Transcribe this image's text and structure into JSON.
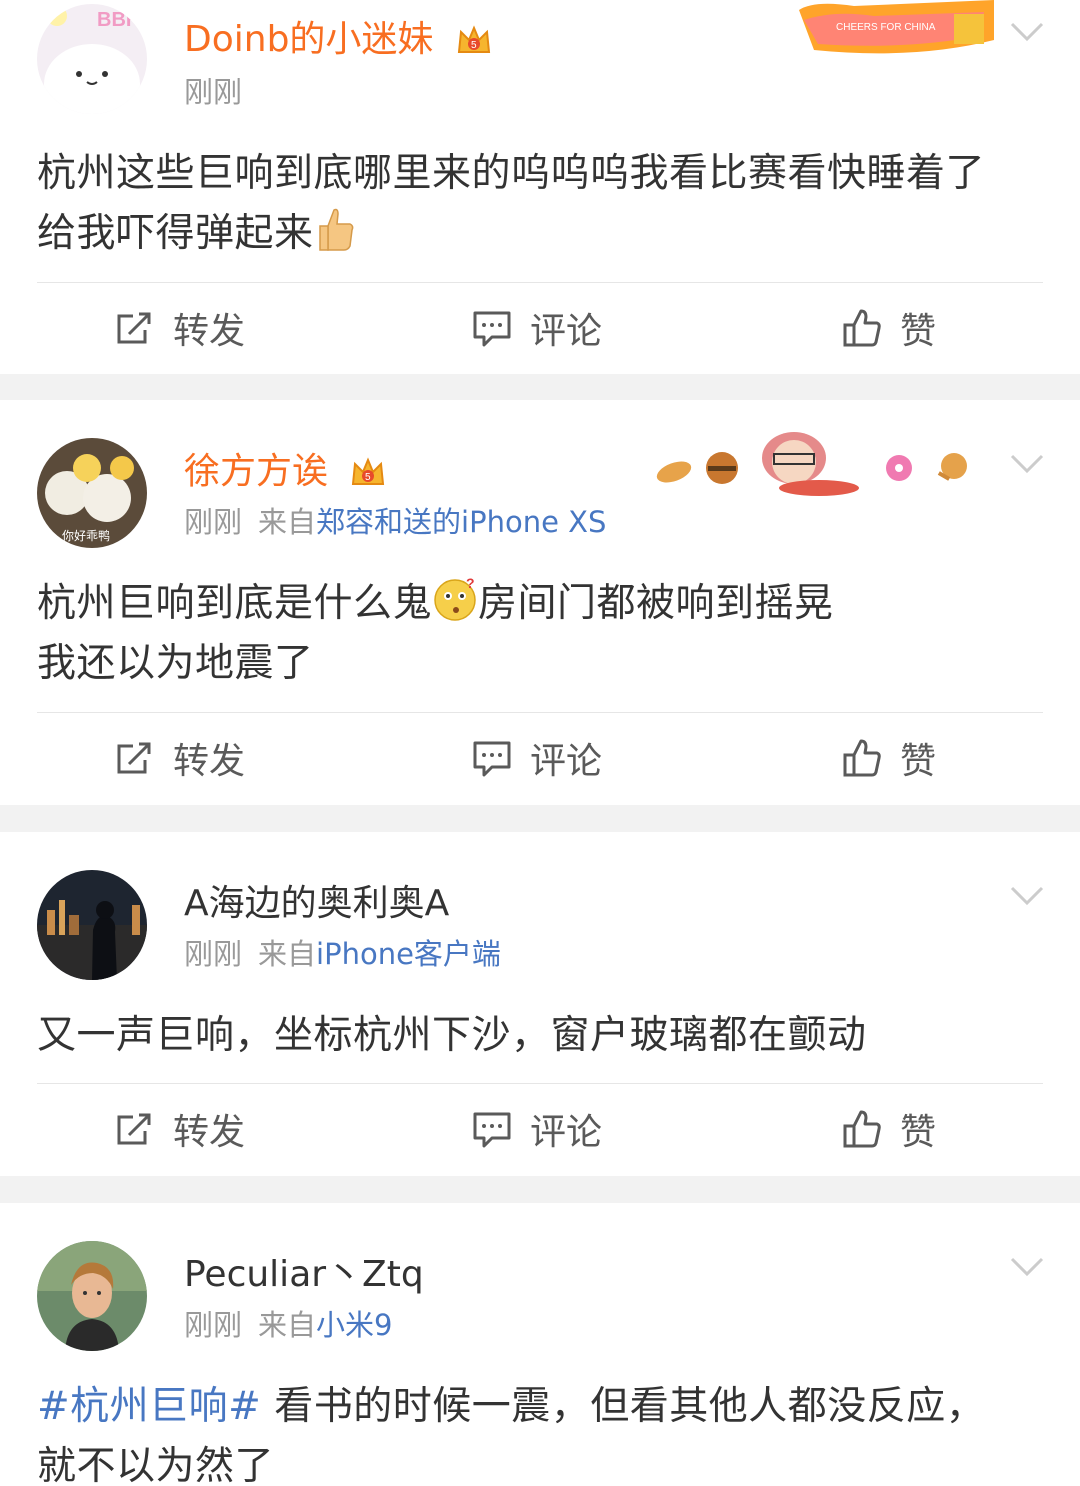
{
  "posts": [
    {
      "username": "Doinb的小迷妹",
      "vip": true,
      "time": "刚刚",
      "source_prefix": "",
      "source_device": "",
      "text_lines": [
        "杭州这些巨响到底哪里来的呜呜呜我看比赛看快睡着了",
        "给我吓得弹起来"
      ],
      "decoration_text": "CHEERS FOR CHINA",
      "avatar_text": "BBH"
    },
    {
      "username": "徐方方诶",
      "vip": true,
      "time": "刚刚",
      "source_prefix": "来自",
      "source_device": "郑容和送的iPhone XS",
      "text_lines": [
        "杭州巨响到底是什么鬼",
        "房间门都被响到摇晃",
        "我还以为地震了"
      ],
      "avatar_text": "你好乖鸭"
    },
    {
      "username": "A海边的奥利奥A",
      "vip": false,
      "time": "刚刚",
      "source_prefix": "来自",
      "source_device": "iPhone客户端",
      "text_lines": [
        "又一声巨响，坐标杭州下沙，窗户玻璃都在颤动"
      ]
    },
    {
      "username": "Peculiar丶Ztq",
      "vip": false,
      "time": "刚刚",
      "source_prefix": "来自",
      "source_device": "小米9",
      "topic": "#杭州巨响#",
      "text_lines": [
        " 看书的时候一震，但看其他人都没反应，",
        "就不以为然了"
      ]
    }
  ],
  "actions": {
    "repost": "转发",
    "comment": "评论",
    "like": "赞"
  },
  "icons": {
    "repost": "repost-icon",
    "comment": "comment-icon",
    "like": "thumbs-up-icon",
    "more": "chevron-down-icon",
    "vip": "crown-icon"
  },
  "colors": {
    "vip_name": "#f86e21",
    "link": "#4877c2",
    "meta": "#999999",
    "text": "#333333",
    "background": "#f2f2f2"
  }
}
